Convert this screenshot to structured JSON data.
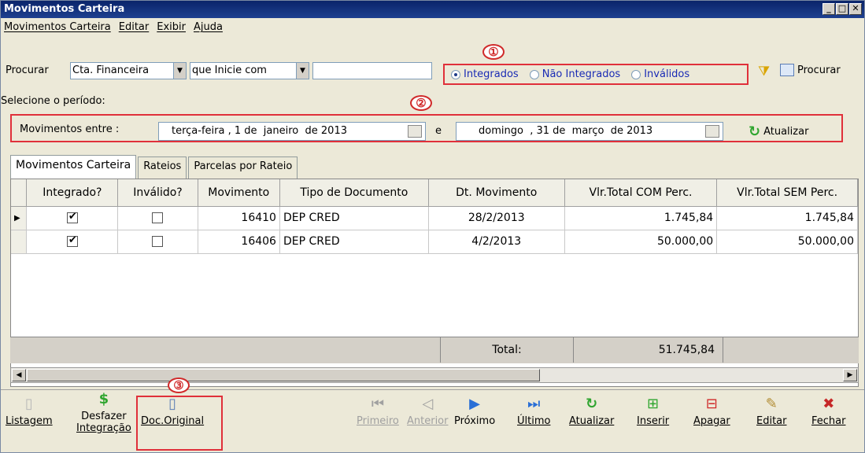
{
  "window": {
    "title": "Movimentos Carteira",
    "buttons": [
      "_",
      "□",
      "✕"
    ]
  },
  "menu": [
    "Movimentos Carteira",
    "Editar",
    "Exibir",
    "Ajuda"
  ],
  "search": {
    "label": "Procurar",
    "field": "Cta. Financeira",
    "operator": "que Inicie com",
    "value": "",
    "button": "Procurar"
  },
  "filter": {
    "options": [
      "Integrados",
      "Não Integrados",
      "Inválidos"
    ],
    "selected": "Integrados"
  },
  "callouts": [
    "①",
    "②",
    "③"
  ],
  "period": {
    "label": "Selecione o período:",
    "between_label": "Movimentos entre :",
    "start": {
      "weekday": "terça-feira",
      "day": "1 de",
      "month": "janeiro",
      "year": "de 2013"
    },
    "conj": "e",
    "end": {
      "weekday": "domingo",
      "day": ", 31 de",
      "month": "março",
      "year": "de 2013"
    },
    "refresh": "Atualizar"
  },
  "tabs": [
    "Movimentos Carteira",
    "Rateios",
    "Parcelas por Rateio"
  ],
  "grid": {
    "columns": [
      "Integrado?",
      "Inválido?",
      "Movimento",
      "Tipo de Documento",
      "Dt. Movimento",
      "Vlr.Total COM Perc.",
      "Vlr.Total SEM Perc."
    ],
    "rows": [
      {
        "integrado": true,
        "invalido": false,
        "movimento": "16410",
        "tipo": "DEP CRED",
        "data": "28/2/2013",
        "com": "1.745,84",
        "sem": "1.745,84"
      },
      {
        "integrado": true,
        "invalido": false,
        "movimento": "16406",
        "tipo": "DEP CRED",
        "data": "4/2/2013",
        "com": "50.000,00",
        "sem": "50.000,00"
      }
    ],
    "total_label": "Total:",
    "total_value": "51.745,84"
  },
  "toolbar": {
    "listagem": "Listagem",
    "desfazer1": "Desfazer",
    "desfazer2": "Integração",
    "doc": "Doc.Original",
    "primeiro": "Primeiro",
    "anterior": "Anterior",
    "proximo": "Próximo",
    "ultimo": "Último",
    "atualizar": "Atualizar",
    "inserir": "Inserir",
    "apagar": "Apagar",
    "editar": "Editar",
    "fechar": "Fechar"
  },
  "colors": {
    "title": "#0a246a",
    "highlight": "#e0303a",
    "radio_text": "#1a2bb5"
  }
}
